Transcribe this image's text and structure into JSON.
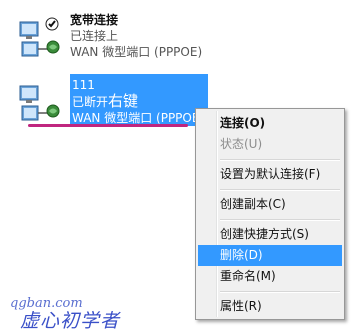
{
  "connections": [
    {
      "name": "宽带连接",
      "status": "已连接上",
      "device": "WAN 微型端口 (PPPOE)",
      "state": "connected"
    },
    {
      "name": "111",
      "status": "已断开",
      "annotation": "右键",
      "device": "WAN 微型端口 (PPPOE)",
      "state": "disconnected",
      "selected": true
    }
  ],
  "context_menu": {
    "items": [
      {
        "label": "连接(O)",
        "style": "bold"
      },
      {
        "label": "状态(U)",
        "style": "disabled"
      },
      {
        "label": "设置为默认连接(F)"
      },
      {
        "label": "创建副本(C)"
      },
      {
        "label": "创建快捷方式(S)"
      },
      {
        "label": "删除(D)",
        "style": "highlighted"
      },
      {
        "label": "重命名(M)"
      },
      {
        "label": "属性(R)"
      }
    ]
  },
  "watermark": {
    "logo": "qgban.com",
    "text": "虚心初学者"
  },
  "colors": {
    "selection": "#3399ff",
    "underline": "#c0267f",
    "menu_bg": "#f0f0f0"
  }
}
